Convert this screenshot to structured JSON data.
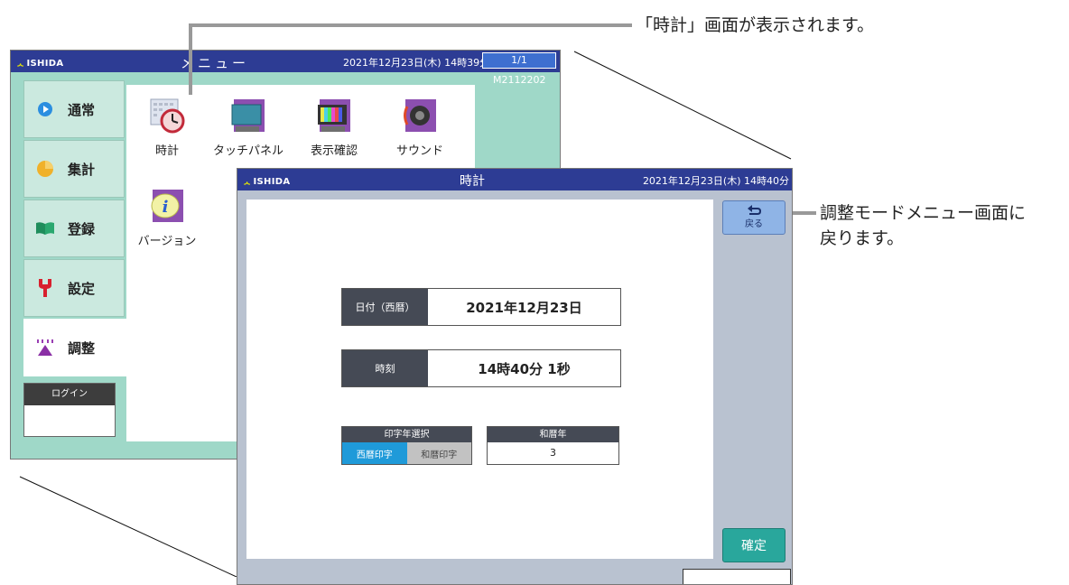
{
  "menu_screen": {
    "logo": "ISHIDA",
    "title": "メニュー",
    "datetime": "2021年12月23日(木) 14時39分",
    "page": "1/1",
    "model": "M2112202",
    "side_items": [
      {
        "label": "通常",
        "icon": "play-circle-icon"
      },
      {
        "label": "集計",
        "icon": "pie-icon"
      },
      {
        "label": "登録",
        "icon": "book-icon"
      },
      {
        "label": "設定",
        "icon": "wrench-icon"
      },
      {
        "label": "調整",
        "icon": "adjust-icon"
      }
    ],
    "login_label": "ログイン",
    "tiles": [
      {
        "label": "時計",
        "icon": "clock-icon"
      },
      {
        "label": "タッチパネル",
        "icon": "touch-panel-icon"
      },
      {
        "label": "表示確認",
        "icon": "display-check-icon"
      },
      {
        "label": "サウンド",
        "icon": "speaker-icon"
      },
      {
        "label": "バージョン",
        "icon": "info-icon"
      }
    ]
  },
  "clock_screen": {
    "logo": "ISHIDA",
    "title": "時計",
    "datetime": "2021年12月23日(木) 14時40分",
    "date_label": "日付（西暦）",
    "date_value": "2021年12月23日",
    "time_label": "時刻",
    "time_value": "14時40分 1秒",
    "print_year_title": "印字年選択",
    "print_year_options": [
      "西暦印字",
      "和暦印字"
    ],
    "print_year_selected": "西暦印字",
    "era_year_title": "和暦年",
    "era_year_value": "3",
    "back_label": "戻る",
    "confirm_label": "確定"
  },
  "annotations": {
    "top": "「時計」画面が表示されます。",
    "right_line1": "調整モードメニュー画面に",
    "right_line2": "戻ります。"
  },
  "colors": {
    "header": "#2d3c94",
    "menu_bg": "#9fd8c8",
    "selected_segment": "#1f9ad9",
    "confirm_button": "#29a79c",
    "back_button": "#8fb4e6"
  }
}
